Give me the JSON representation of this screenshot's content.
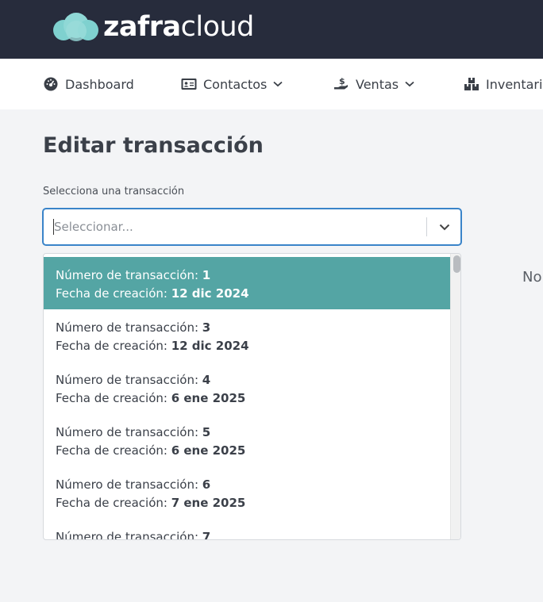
{
  "brand": {
    "bold": "zafra",
    "light": "cloud"
  },
  "nav": [
    {
      "label": "Dashboard"
    },
    {
      "label": "Contactos"
    },
    {
      "label": "Ventas"
    },
    {
      "label": "Inventari"
    }
  ],
  "page": {
    "title": "Editar transacción",
    "field_label": "Selecciona una transacción",
    "placeholder": "Seleccionar...",
    "side_text": "No"
  },
  "options": [
    {
      "num_label": "Número de transacción: ",
      "num": "1",
      "date_label": "Fecha de creación: ",
      "date": "12 dic 2024",
      "active": true
    },
    {
      "num_label": "Número de transacción: ",
      "num": "3",
      "date_label": "Fecha de creación: ",
      "date": "12 dic 2024"
    },
    {
      "num_label": "Número de transacción: ",
      "num": "4",
      "date_label": "Fecha de creación: ",
      "date": "6 ene 2025"
    },
    {
      "num_label": "Número de transacción: ",
      "num": "5",
      "date_label": "Fecha de creación: ",
      "date": "6 ene 2025"
    },
    {
      "num_label": "Número de transacción: ",
      "num": "6",
      "date_label": "Fecha de creación: ",
      "date": "7 ene 2025"
    },
    {
      "num_label": "Número de transacción: ",
      "num": "7",
      "date_label": "",
      "date": ""
    }
  ],
  "colors": {
    "header_bg": "#272c3c",
    "accent": "#54a5a4",
    "focus": "#3a84c9",
    "logo_teal": "#7fd1cf"
  },
  "icons": {
    "logo": "cloud-icon",
    "dashboard": "dashboard-icon",
    "contacts": "contact-card-icon",
    "sales": "hand-money-icon",
    "inventory": "boxes-icon",
    "chevron": "chevron-down-icon"
  }
}
